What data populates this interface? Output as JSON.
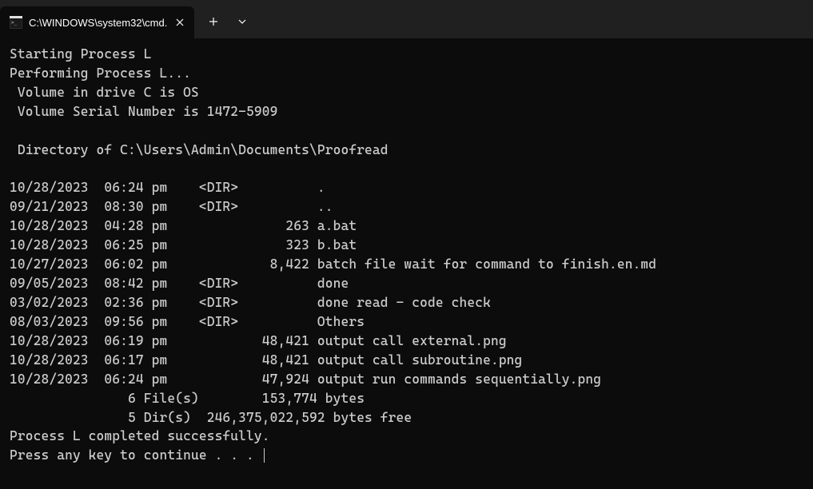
{
  "tab": {
    "title": "C:\\WINDOWS\\system32\\cmd."
  },
  "terminal": {
    "lines": [
      "Starting Process L",
      "Performing Process L...",
      " Volume in drive C is OS",
      " Volume Serial Number is 1472-5909",
      "",
      " Directory of C:\\Users\\Admin\\Documents\\Proofread",
      "",
      "10/28/2023  06:24 pm    <DIR>          .",
      "09/21/2023  08:30 pm    <DIR>          ..",
      "10/28/2023  04:28 pm               263 a.bat",
      "10/28/2023  06:25 pm               323 b.bat",
      "10/27/2023  06:02 pm             8,422 batch file wait for command to finish.en.md",
      "09/05/2023  08:42 pm    <DIR>          done",
      "03/02/2023  02:36 pm    <DIR>          done read - code check",
      "08/03/2023  09:56 pm    <DIR>          Others",
      "10/28/2023  06:19 pm            48,421 output call external.png",
      "10/28/2023  06:17 pm            48,421 output call subroutine.png",
      "10/28/2023  06:24 pm            47,924 output run commands sequentially.png",
      "               6 File(s)        153,774 bytes",
      "               5 Dir(s)  246,375,022,592 bytes free",
      "Process L completed successfully.",
      "Press any key to continue . . . "
    ]
  }
}
